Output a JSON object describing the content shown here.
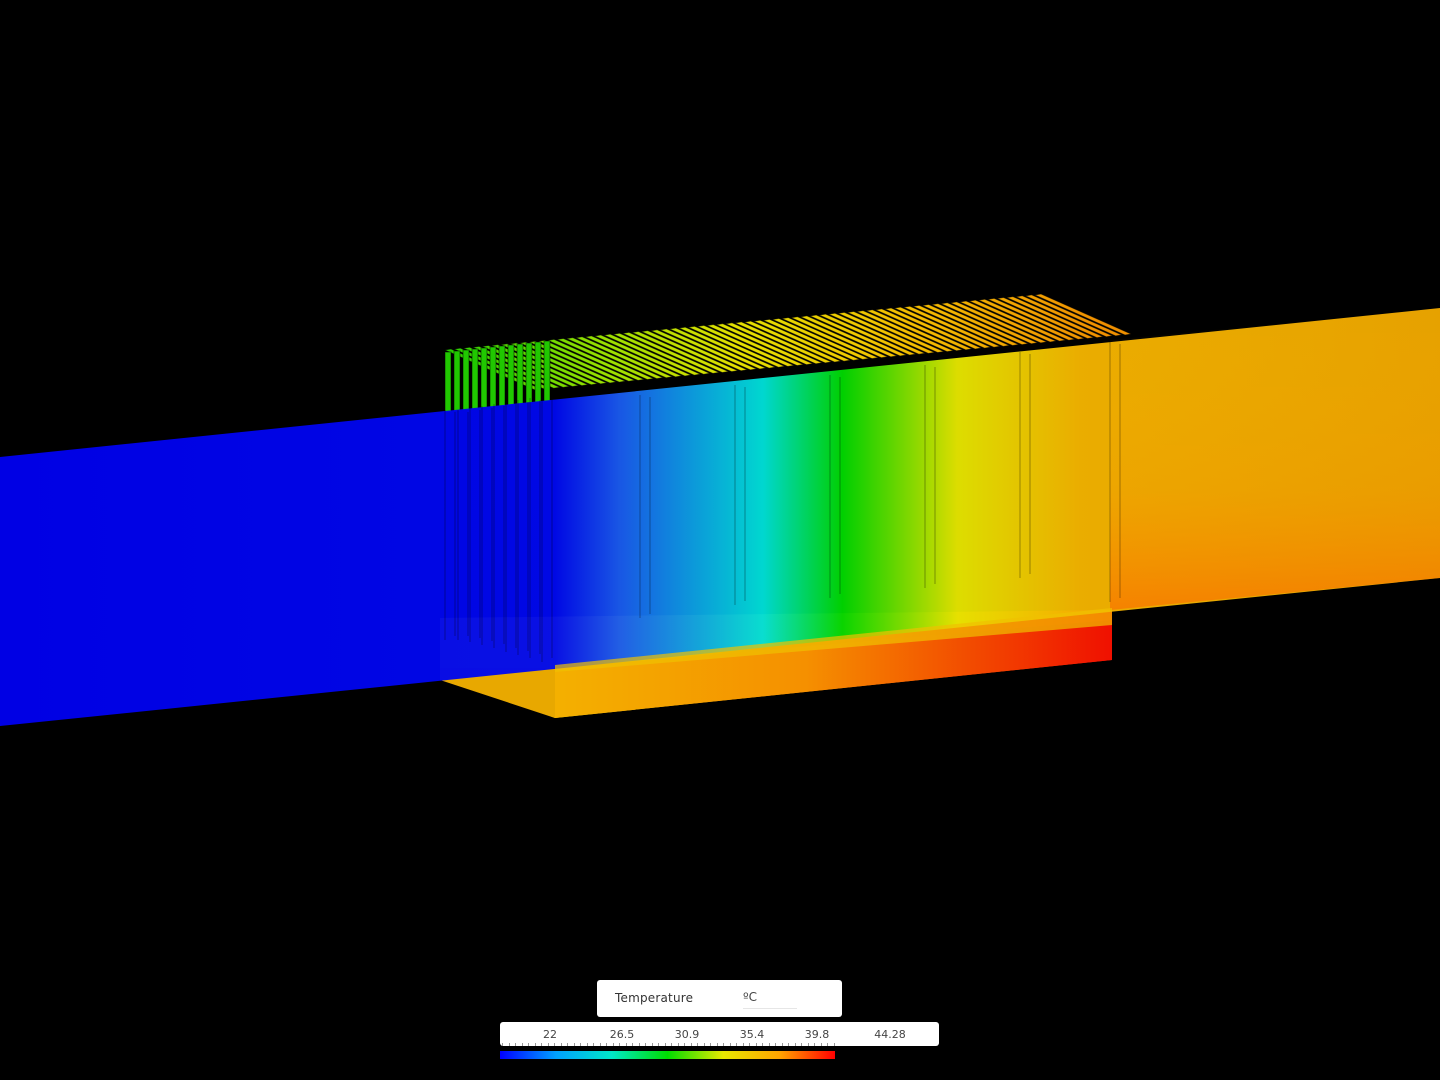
{
  "legend": {
    "quantity": "Temperature",
    "unit": "ºC",
    "min": 22,
    "max": 44.28,
    "ticks": [
      "22",
      "26.5",
      "30.9",
      "35.4",
      "39.8",
      "44.28"
    ],
    "colormap": [
      "#0000ff",
      "#00a0ff",
      "#00e8c8",
      "#00dd00",
      "#e8e800",
      "#ffa500",
      "#ff0000"
    ]
  },
  "scene": {
    "background": "#000000"
  }
}
